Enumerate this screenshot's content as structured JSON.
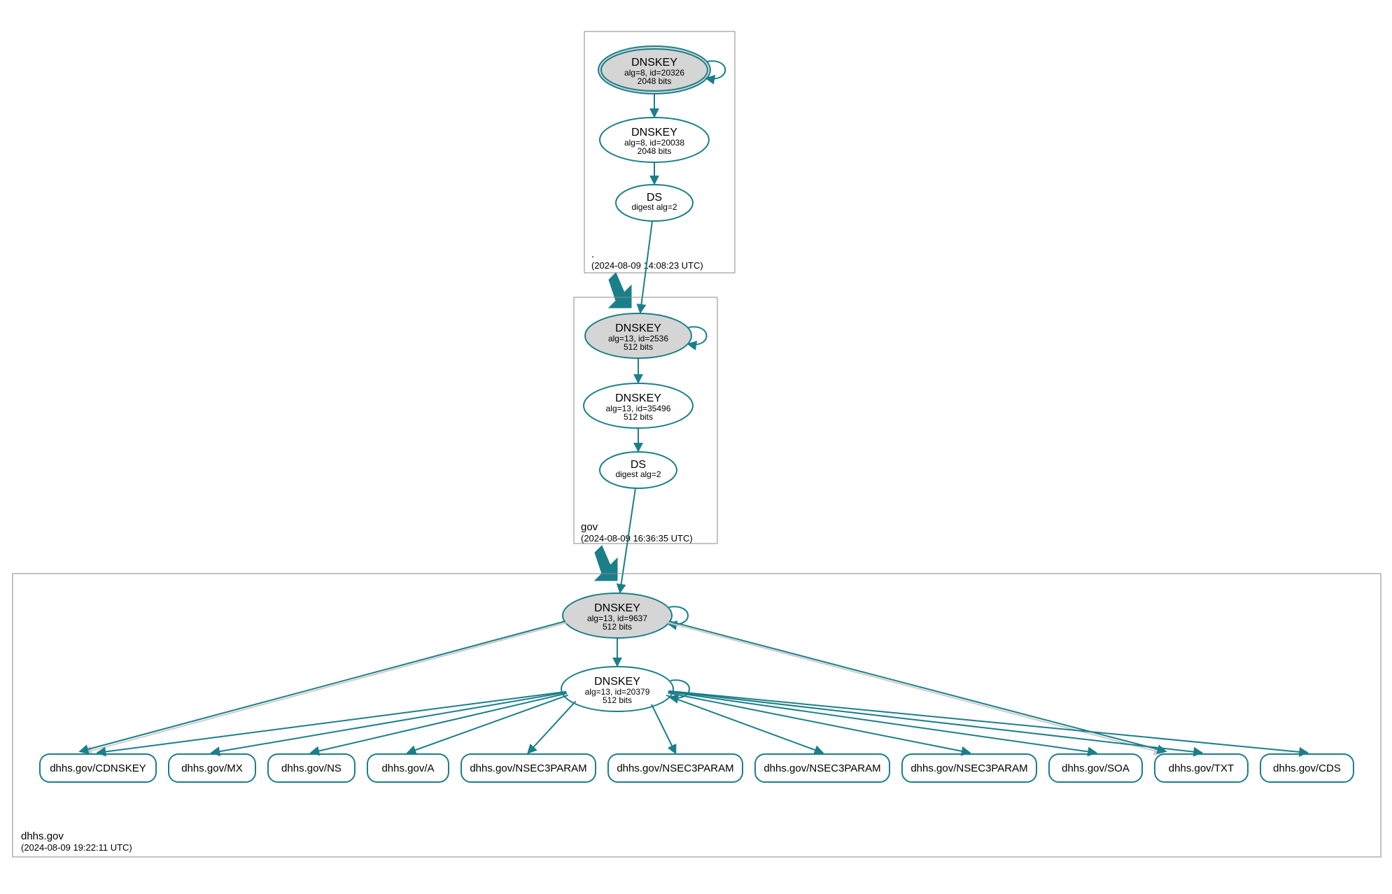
{
  "colors": {
    "accent": "#1b7f8a",
    "ksk_fill": "#d5d5d5",
    "box_stroke": "#888888"
  },
  "zones": {
    "root": {
      "label": ".",
      "timestamp": "(2024-08-09 14:08:23 UTC)",
      "nodes": {
        "ksk": {
          "title": "DNSKEY",
          "line1": "alg=8, id=20326",
          "line2": "2048 bits"
        },
        "zsk": {
          "title": "DNSKEY",
          "line1": "alg=8, id=20038",
          "line2": "2048 bits"
        },
        "ds": {
          "title": "DS",
          "line1": "digest alg=2"
        }
      }
    },
    "gov": {
      "label": "gov",
      "timestamp": "(2024-08-09 16:36:35 UTC)",
      "nodes": {
        "ksk": {
          "title": "DNSKEY",
          "line1": "alg=13, id=2536",
          "line2": "512 bits"
        },
        "zsk": {
          "title": "DNSKEY",
          "line1": "alg=13, id=35496",
          "line2": "512 bits"
        },
        "ds": {
          "title": "DS",
          "line1": "digest alg=2"
        }
      }
    },
    "dhhs": {
      "label": "dhhs.gov",
      "timestamp": "(2024-08-09 19:22:11 UTC)",
      "nodes": {
        "ksk": {
          "title": "DNSKEY",
          "line1": "alg=13, id=9637",
          "line2": "512 bits"
        },
        "zsk": {
          "title": "DNSKEY",
          "line1": "alg=13, id=20379",
          "line2": "512 bits"
        }
      },
      "rrsets": [
        "dhhs.gov/CDNSKEY",
        "dhhs.gov/MX",
        "dhhs.gov/NS",
        "dhhs.gov/A",
        "dhhs.gov/NSEC3PARAM",
        "dhhs.gov/NSEC3PARAM",
        "dhhs.gov/NSEC3PARAM",
        "dhhs.gov/NSEC3PARAM",
        "dhhs.gov/SOA",
        "dhhs.gov/TXT",
        "dhhs.gov/CDS"
      ]
    }
  }
}
